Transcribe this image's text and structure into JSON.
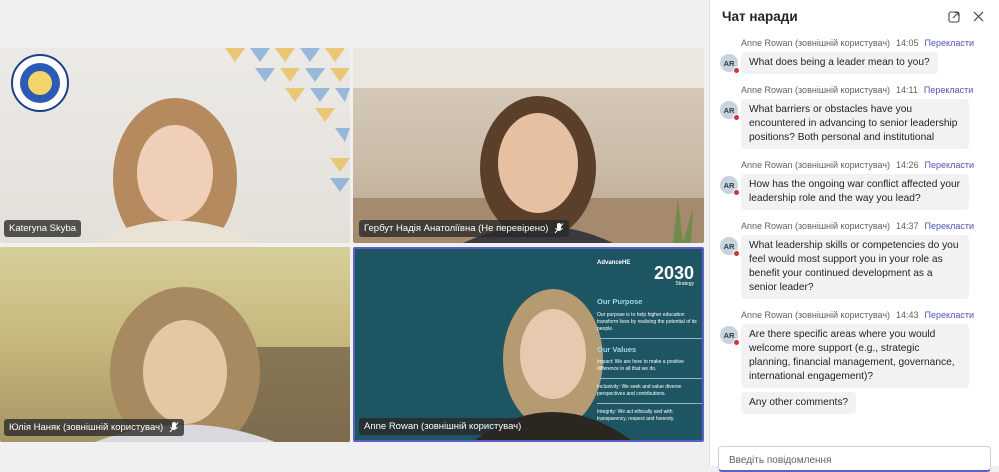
{
  "participants": [
    {
      "name": "Kateryna Skyba",
      "muted": false
    },
    {
      "name": "Гербут Надія Анатоліївна (Не перевірено)",
      "muted": true
    },
    {
      "name": "Юлія Наняк (зовнішній користувач)",
      "muted": true
    },
    {
      "name": "Anne Rowan (зовнішній користувач)",
      "muted": false,
      "active": true
    }
  ],
  "slide": {
    "brand": "AdvanceHE",
    "big": "2030",
    "strategy": "Strategy",
    "purpose_title": "Our Purpose",
    "purpose_text": "Our purpose is to help higher education transform lives by realising the potential of its people.",
    "values_title": "Our Values",
    "impact": "Impact: We are here to make a positive difference in all that we do.",
    "inclusivity": "Inclusivity: We seek and value diverse perspectives and contributions.",
    "integrity": "Integrity: We act ethically and with transparency, respect and honesty."
  },
  "chat": {
    "title": "Чат наради",
    "translate_label": "Перекласти",
    "compose_placeholder": "Введіть повідомлення",
    "messages": [
      {
        "author": "Anne Rowan (зовнішній користувач)",
        "time": "14:05",
        "initials": "AR",
        "text": "What does being a leader mean to you?"
      },
      {
        "author": "Anne Rowan (зовнішній користувач)",
        "time": "14:11",
        "initials": "AR",
        "text": "What barriers or obstacles have you encountered in advancing to senior leadership positions? Both personal and institutional"
      },
      {
        "author": "Anne Rowan (зовнішній користувач)",
        "time": "14:26",
        "initials": "AR",
        "text": "How has the ongoing war conflict affected your leadership role and the way you lead?"
      },
      {
        "author": "Anne Rowan (зовнішній користувач)",
        "time": "14:37",
        "initials": "AR",
        "text": "What leadership skills or competencies do you feel would most support you in your role as benefit your continued development as a senior leader?"
      },
      {
        "author": "Anne Rowan (зовнішній користувач)",
        "time": "14:43",
        "initials": "AR",
        "text": "Are there specific areas where you would welcome more support (e.g., strategic planning, financial management, governance, international engagement)?",
        "followup": "Any other comments?"
      }
    ]
  }
}
